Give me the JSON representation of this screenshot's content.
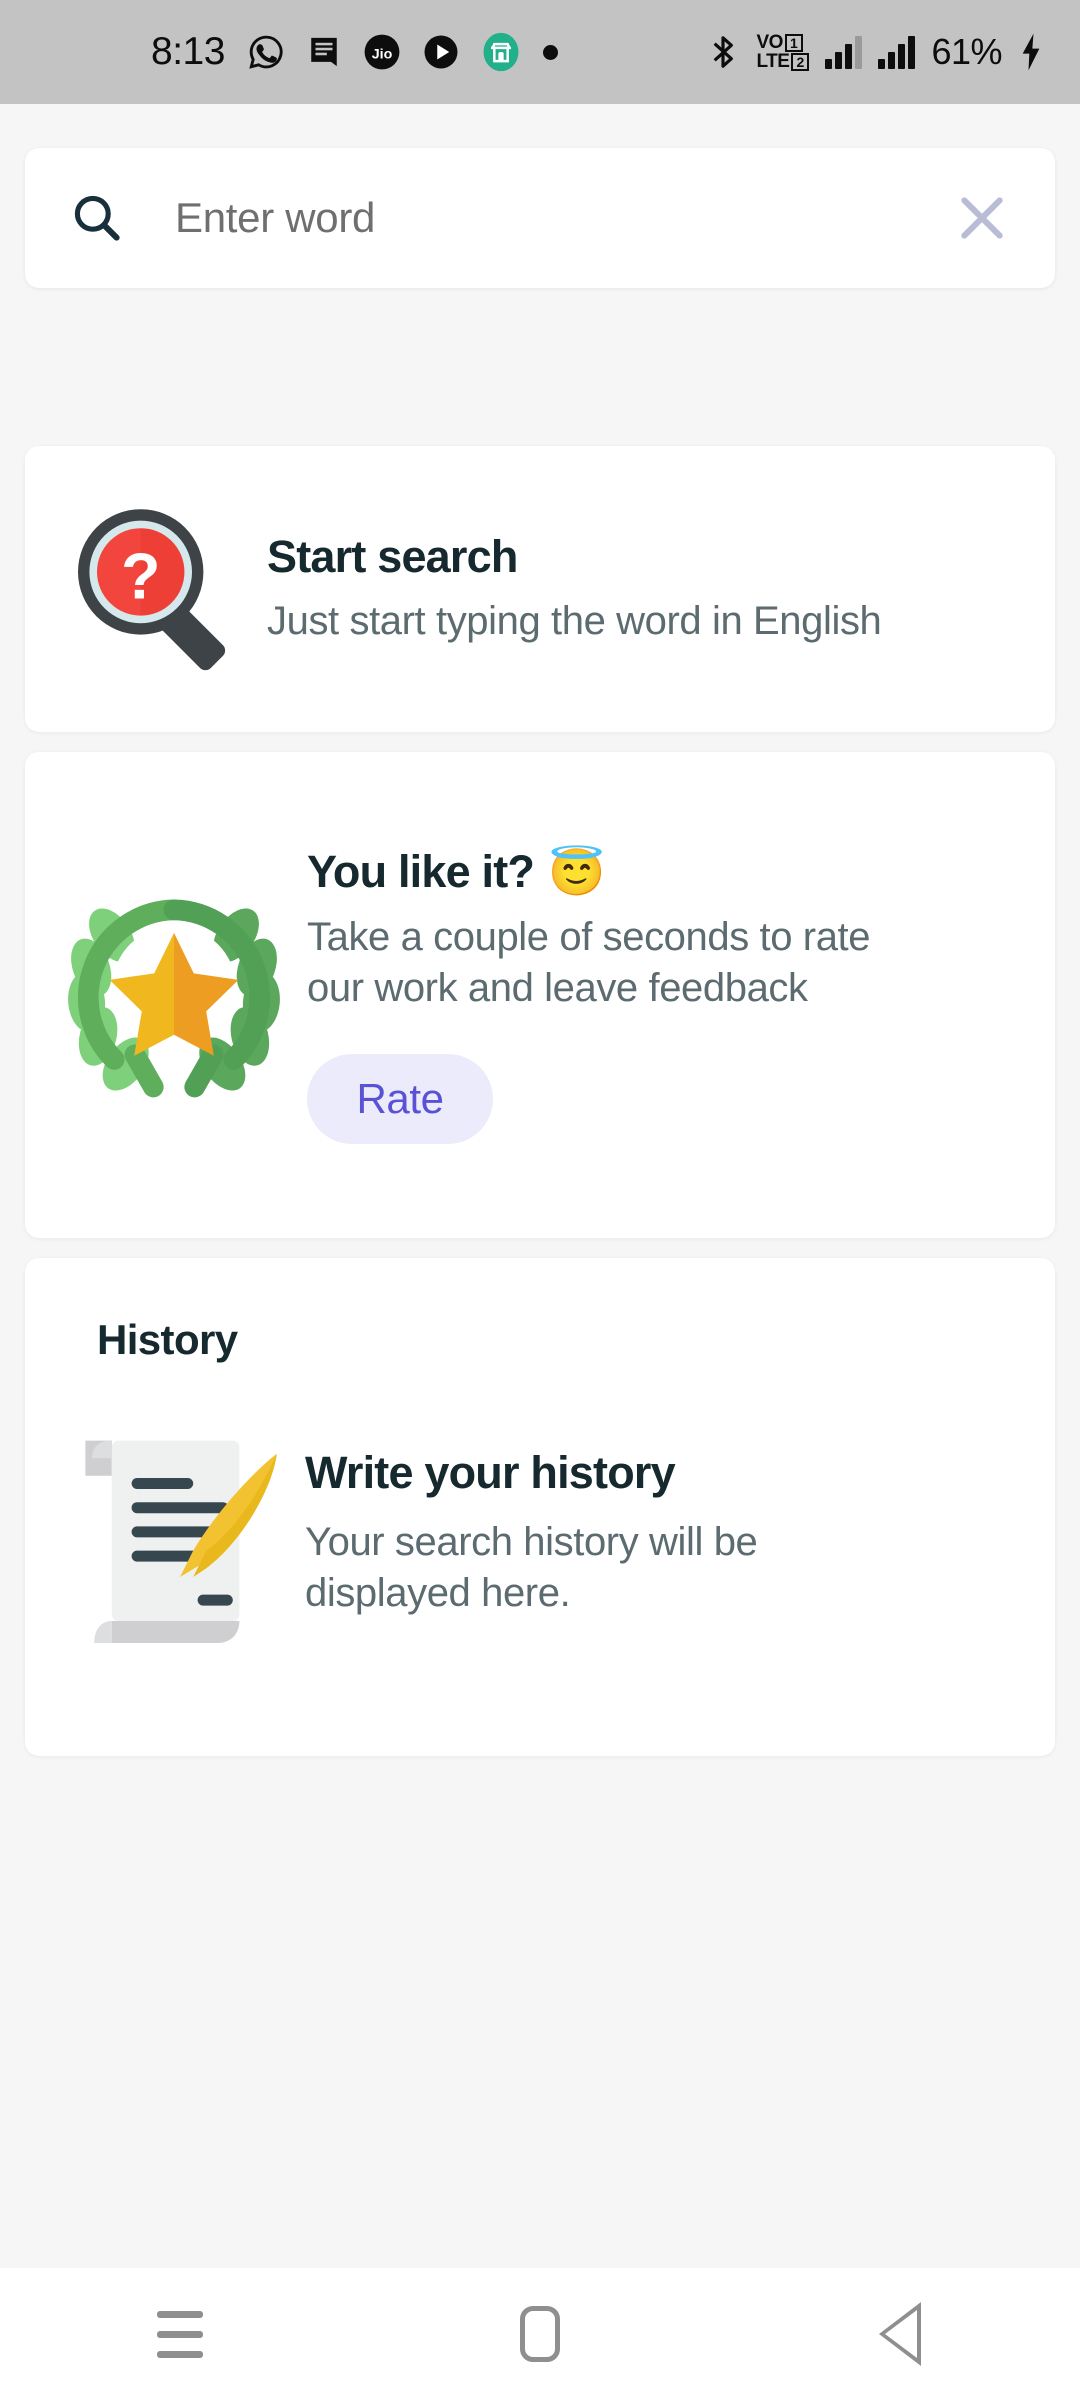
{
  "status_bar": {
    "time": "8:13",
    "notification_icons": [
      "whatsapp-icon",
      "message-icon",
      "jio-icon",
      "play-icon",
      "store-icon",
      "dot-icon"
    ],
    "bluetooth": "bluetooth-icon",
    "network_label": "VoLTE",
    "sim1": "1",
    "sim2": "2",
    "battery_percent": "61%",
    "charging": "charging-bolt-icon",
    "background_color": "#c3c3c3"
  },
  "search": {
    "placeholder": "Enter word",
    "search_icon": "search-icon",
    "clear_icon": "close-icon"
  },
  "cards": {
    "start_search": {
      "title": "Start search",
      "subtitle": "Just start typing the word in English",
      "icon": "magnifier-question-icon"
    },
    "rate": {
      "title": "You like it?",
      "emoji": "😇",
      "subtitle": "Take a couple of seconds to rate our work and leave feedback",
      "button_label": "Rate",
      "button_bg": "#ecebfb",
      "button_text_color": "#5a52d5",
      "icon": "laurel-star-icon"
    },
    "history": {
      "heading": "History",
      "title": "Write your history",
      "subtitle": "Your search history will be displayed here.",
      "icon": "scroll-quill-icon"
    }
  },
  "nav_bar": {
    "recent_label": "recent-apps-icon",
    "home_label": "home-icon",
    "back_label": "back-icon"
  },
  "colors": {
    "page_background": "#f6f6f7",
    "card_background": "#ffffff",
    "title_text": "#15292f",
    "body_text": "#5b6b70",
    "placeholder_text": "#6f6f6f",
    "accent_purple": "#5a52d5"
  }
}
